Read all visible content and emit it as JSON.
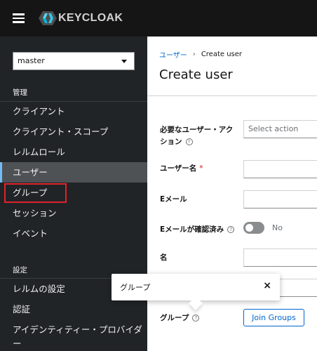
{
  "header": {
    "logo_text": "KEYCLOAK"
  },
  "sidebar": {
    "realm": "master",
    "section_manage": "管理",
    "section_configure": "設定",
    "items": [
      {
        "label": "クライアント"
      },
      {
        "label": "クライアント・スコープ"
      },
      {
        "label": "レルムロール"
      },
      {
        "label": "ユーザー"
      },
      {
        "label": "グループ"
      },
      {
        "label": "セッション"
      },
      {
        "label": "イベント"
      },
      {
        "label": "レルムの設定"
      },
      {
        "label": "認証"
      },
      {
        "label": "アイデンティティー・プロバイダー"
      }
    ]
  },
  "breadcrumb": {
    "link": "ユーザー",
    "current": "Create user"
  },
  "page": {
    "title": "Create user"
  },
  "form": {
    "required_action_label_1": "必要なユーザー・アク",
    "required_action_label_2": "ション",
    "required_action_placeholder": "Select action",
    "username_label": "ユーザー名",
    "required_mark": "*",
    "email_label": "Eメール",
    "email_verified_label": "Eメールが確認済み",
    "email_verified_value": "No",
    "first_name_label": "名",
    "groups_label": "グループ",
    "join_groups_button": "Join Groups"
  },
  "tooltip": {
    "text": "グループ",
    "close": "×"
  },
  "icons": {
    "help": "?"
  }
}
